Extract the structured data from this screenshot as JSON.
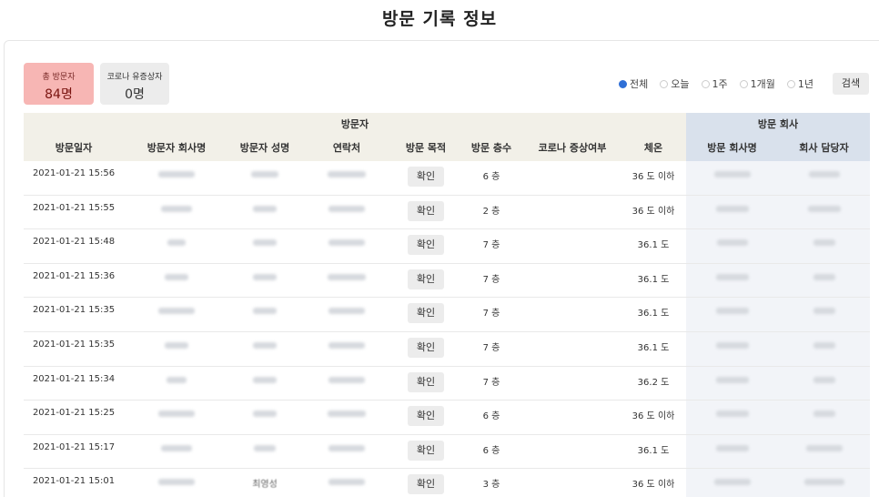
{
  "title": "방문 기록 정보",
  "stats": {
    "total_label": "총 방문자",
    "total_value": "84명",
    "covid_label": "코로나 유증상자",
    "covid_value": "0명"
  },
  "filters": [
    {
      "label": "전체",
      "selected": true
    },
    {
      "label": "오늘",
      "selected": false
    },
    {
      "label": "1주",
      "selected": false
    },
    {
      "label": "1개월",
      "selected": false
    },
    {
      "label": "1년",
      "selected": false
    }
  ],
  "search_label": "검색",
  "table": {
    "group_visitor": "방문자",
    "group_company": "방문 회사",
    "columns": [
      "방문일자",
      "방문자 회사명",
      "방문자 성명",
      "연락처",
      "방문 목적",
      "방문 층수",
      "코로나 증상여부",
      "체온",
      "방문 회사명",
      "회사 담당자"
    ],
    "confirm_label": "확인",
    "rows": [
      {
        "date": "2021-01-21 15:56",
        "floor": "6 층",
        "temp": "36 도 이하"
      },
      {
        "date": "2021-01-21 15:55",
        "floor": "2 층",
        "temp": "36 도 이하"
      },
      {
        "date": "2021-01-21 15:48",
        "floor": "7 층",
        "temp": "36.1 도"
      },
      {
        "date": "2021-01-21 15:36",
        "floor": "7 층",
        "temp": "36.1 도"
      },
      {
        "date": "2021-01-21 15:35",
        "floor": "7 층",
        "temp": "36.1 도"
      },
      {
        "date": "2021-01-21 15:35",
        "floor": "7 층",
        "temp": "36.1 도"
      },
      {
        "date": "2021-01-21 15:34",
        "floor": "7 층",
        "temp": "36.2 도"
      },
      {
        "date": "2021-01-21 15:25",
        "floor": "6 층",
        "temp": "36 도 이하"
      },
      {
        "date": "2021-01-21 15:17",
        "floor": "6 층",
        "temp": "36.1 도"
      },
      {
        "date": "2021-01-21 15:01",
        "floor": "3 층",
        "temp": "36 도 이하",
        "visitor_name": "최영성"
      }
    ]
  },
  "colors": {
    "accent": "#2f6fd6",
    "total_bg": "#f7b6b4",
    "visitor_header": "#f2f0e8",
    "company_header": "#d9e1ec"
  }
}
